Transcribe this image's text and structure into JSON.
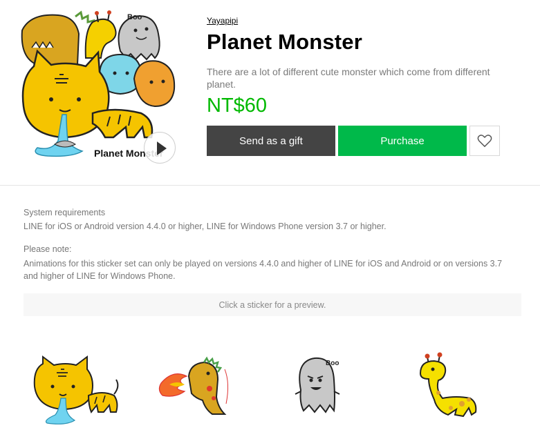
{
  "product": {
    "author": "Yayapipi",
    "title": "Planet Monster",
    "description": "There are a lot of different cute monster which come from different planet.",
    "price": "NT$60",
    "cover_text": "Planet Monster",
    "cover_ghost_text": "Boo"
  },
  "actions": {
    "gift_label": "Send as a gift",
    "purchase_label": "Purchase"
  },
  "info": {
    "requirements_label": "System requirements",
    "requirements_text": "LINE for iOS or Android version 4.4.0 or higher, LINE for Windows Phone version 3.7 or higher.",
    "note_label": "Please note:",
    "note_text": "Animations for this sticker set can only be played on versions 4.4.0 and higher of LINE for iOS and Android or on versions 3.7 and higher of LINE for Windows Phone."
  },
  "preview": {
    "hint": "Click a sticker for a preview."
  },
  "stickers": {
    "ghost_text": "Boo"
  },
  "colors": {
    "price": "#00b900",
    "purchase_button": "#00b94a",
    "gift_button": "#444444",
    "monster_yellow": "#f5c400",
    "ghost_gray": "#c8c8c8"
  },
  "icons": [
    "play-icon",
    "heart-icon"
  ]
}
